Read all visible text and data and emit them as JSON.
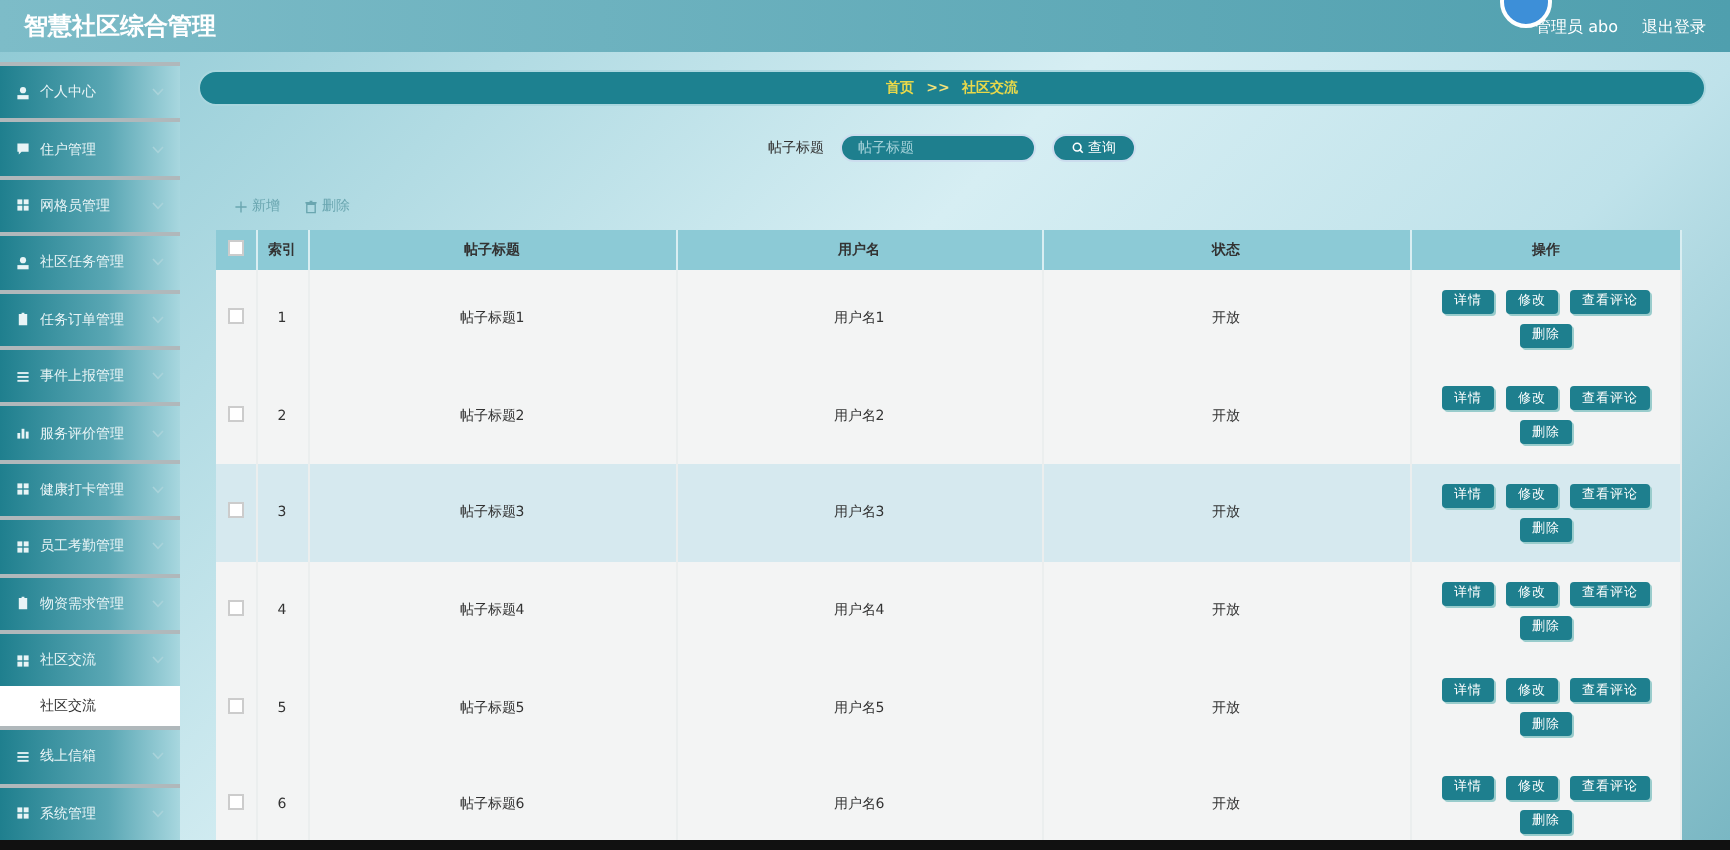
{
  "header": {
    "title": "智慧社区综合管理",
    "user": "管理员 abo",
    "logout": "退出登录"
  },
  "sidebar": {
    "items": [
      {
        "label": "个人中心",
        "expanded": false
      },
      {
        "label": "住户管理",
        "expanded": false
      },
      {
        "label": "网格员管理",
        "expanded": false
      },
      {
        "label": "社区任务管理",
        "expanded": false
      },
      {
        "label": "任务订单管理",
        "expanded": false
      },
      {
        "label": "事件上报管理",
        "expanded": false
      },
      {
        "label": "服务评价管理",
        "expanded": false
      },
      {
        "label": "健康打卡管理",
        "expanded": false
      },
      {
        "label": "员工考勤管理",
        "expanded": false
      },
      {
        "label": "物资需求管理",
        "expanded": false
      },
      {
        "label": "社区交流",
        "expanded": true,
        "children": [
          {
            "label": "社区交流",
            "selected": true
          }
        ]
      },
      {
        "label": "线上信箱",
        "expanded": false
      },
      {
        "label": "系统管理",
        "expanded": false
      }
    ]
  },
  "breadcrumb": [
    "首页",
    ">>",
    "社区交流"
  ],
  "search": {
    "label": "帖子标题",
    "placeholder": "帖子标题",
    "button": "查询"
  },
  "actions": [
    "新增",
    "删除"
  ],
  "table": {
    "columns": [
      "索引",
      "帖子标题",
      "用户名",
      "状态",
      "操作"
    ],
    "rows": [
      {
        "index": "1",
        "title": "帖子标题1",
        "user": "用户名1",
        "status": "开放",
        "checked": false,
        "highlighted": false,
        "buttons": [
          "详情",
          "修改",
          "查看评论",
          "删除"
        ]
      },
      {
        "index": "2",
        "title": "帖子标题2",
        "user": "用户名2",
        "status": "开放",
        "checked": false,
        "highlighted": false,
        "buttons": [
          "详情",
          "修改",
          "查看评论",
          "删除"
        ]
      },
      {
        "index": "3",
        "title": "帖子标题3",
        "user": "用户名3",
        "status": "开放",
        "checked": false,
        "highlighted": true,
        "buttons": [
          "详情",
          "修改",
          "查看评论",
          "删除"
        ]
      },
      {
        "index": "4",
        "title": "帖子标题4",
        "user": "用户名4",
        "status": "开放",
        "checked": false,
        "highlighted": false,
        "buttons": [
          "详情",
          "修改",
          "查看评论",
          "删除"
        ]
      },
      {
        "index": "5",
        "title": "帖子标题5",
        "user": "用户名5",
        "status": "开放",
        "checked": false,
        "highlighted": false,
        "buttons": [
          "详情",
          "修改",
          "查看评论",
          "删除"
        ]
      },
      {
        "index": "6",
        "title": "帖子标题6",
        "user": "用户名6",
        "status": "开放",
        "checked": false,
        "highlighted": false,
        "buttons": [
          "详情",
          "修改",
          "查看评论",
          "删除"
        ]
      }
    ],
    "all_checked": false
  }
}
